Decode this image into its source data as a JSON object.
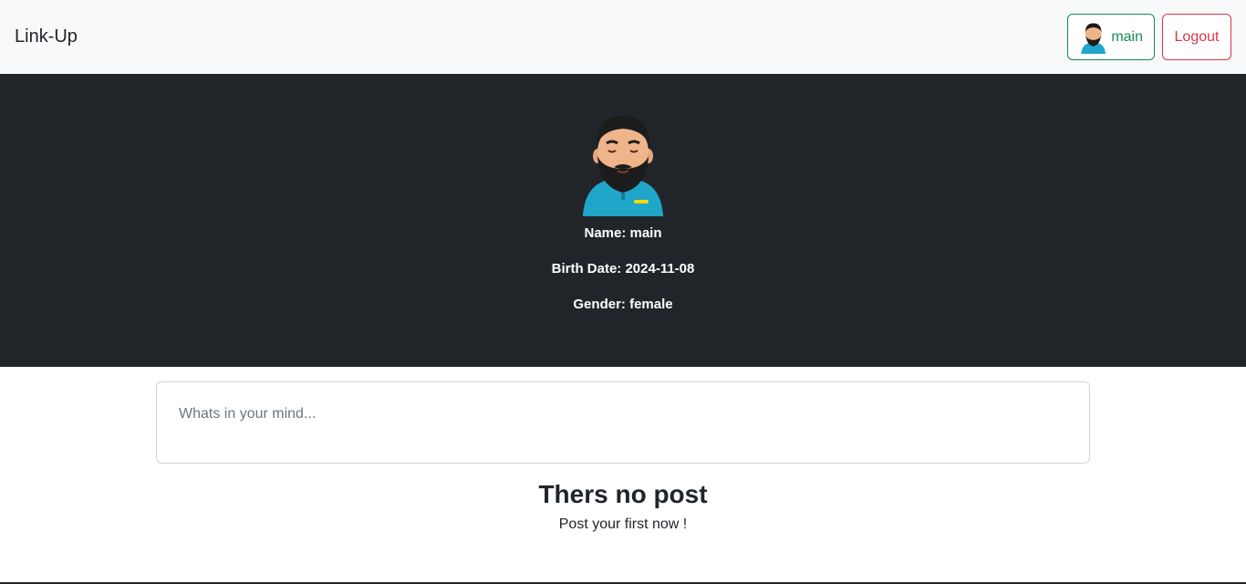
{
  "navbar": {
    "brand": "Link-Up",
    "user_button_label": "main",
    "logout_label": "Logout"
  },
  "profile": {
    "name": "Name: main",
    "birth_date": "Birth Date: 2024-11-08",
    "gender": "Gender: female"
  },
  "composer": {
    "placeholder": "Whats in your mind..."
  },
  "empty_state": {
    "title": "Thers no post",
    "subtitle": "Post your first now !"
  },
  "colors": {
    "navbar_bg": "#f8f9fa",
    "profile_bg": "#212529",
    "success": "#198754",
    "danger": "#dc3545"
  }
}
